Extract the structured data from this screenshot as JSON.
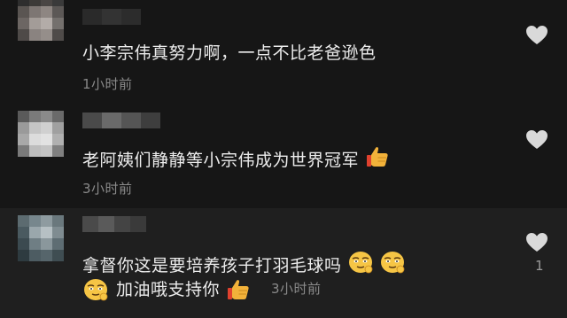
{
  "comments": [
    {
      "text": "小李宗伟真努力啊，一点不比老爸逊色",
      "time": "1小时前"
    },
    {
      "text": "老阿姨们静静等小宗伟成为世界冠军",
      "emoji": "thumbs-up",
      "time": "3小时前"
    },
    {
      "text": "拿督你这是要培养孩子打羽毛球吗",
      "emojis": [
        "grinning-face",
        "grinning-face"
      ],
      "line2_emoji": "grinning-face",
      "line2_text": "加油哦支持你",
      "line2_emoji_end": "thumbs-up",
      "time": "3小时前",
      "like_count": "1"
    }
  ],
  "colors": {
    "background": "#161616",
    "highlight_row": "#1f1f1f",
    "text": "#ececec",
    "muted": "#8a8a8a",
    "heart": "#d9d9d9"
  }
}
